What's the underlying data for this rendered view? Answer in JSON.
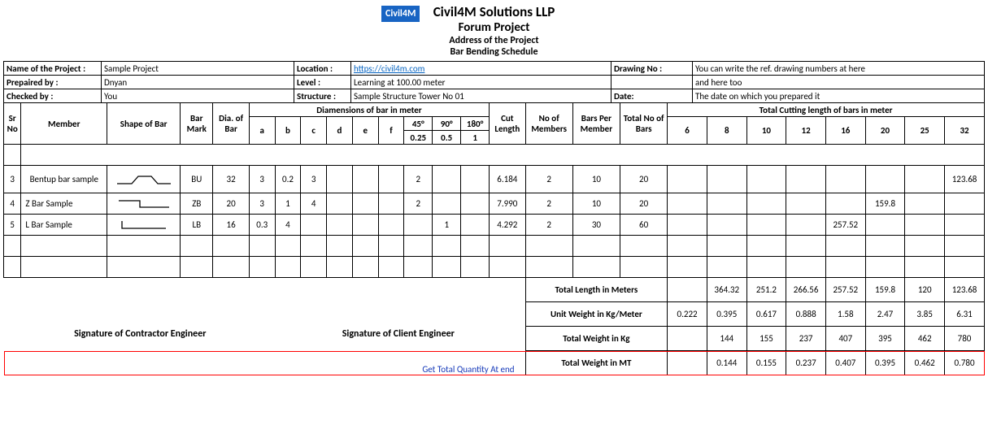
{
  "logo": "Civil4M",
  "title": "Civil4M Solutions LLP",
  "subtitle": "Forum Project",
  "address": "Address of the Project",
  "doc": "Bar Bending Schedule",
  "labels": {
    "name": "Name of the Project :",
    "prep": "Prepaired by :",
    "chk": "Checked by :",
    "loc": "Location :",
    "lvl": "Level :",
    "struct": "Structure :",
    "dwg": "Drawing No :",
    "date": "Date:"
  },
  "info": {
    "name": "Sample Project",
    "prep": "Dnyan",
    "chk": "You",
    "loc_url": "https://civil4m.com",
    "lvl": "Learning at 100.00 meter",
    "struct": "Sample Structure Tower No 01",
    "dwg1": "You can write the ref. drawing numbers at here",
    "dwg2": "and here too",
    "date": "The date on which you prepared it"
  },
  "colhdr": {
    "sr": "Sr No",
    "member": "Member",
    "shape": "Shape of Bar",
    "mark": "Bar Mark",
    "dia": "Dia. of Bar",
    "dims": "Diamensions of bar in meter",
    "a": "a",
    "b": "b",
    "c": "c",
    "d": "d",
    "e": "e",
    "f": "f",
    "d45": "45°",
    "d90": "90°",
    "d180": "180°",
    "cut": "Cut Length",
    "v45": "0.25",
    "v90": "0.5",
    "v180": "1",
    "nomem": "No of Members",
    "bpm": "Bars Per Member",
    "tot": "Total No of Bars",
    "totcut": "Total Cutting length of bars in meter",
    "c6": "6",
    "c8": "8",
    "c10": "10",
    "c12": "12",
    "c16": "16",
    "c20": "20",
    "c25": "25",
    "c32": "32"
  },
  "rows": [
    {
      "sr": "3",
      "member": "Bentup bar sample",
      "shape": "bentup",
      "mark": "BU",
      "dia": "32",
      "a": "3",
      "b": "0.2",
      "c": "3",
      "d45": "2",
      "cut": "6.184",
      "nomem": "2",
      "bpm": "10",
      "tot": "20",
      "c32": "123.68"
    },
    {
      "sr": "4",
      "member": "Z Bar Sample",
      "shape": "zbar",
      "mark": "ZB",
      "dia": "20",
      "a": "3",
      "b": "1",
      "c": "4",
      "d45": "2",
      "cut": "7.990",
      "nomem": "2",
      "bpm": "10",
      "tot": "20",
      "c20": "159.8"
    },
    {
      "sr": "5",
      "member": "L Bar Sample",
      "shape": "lbar",
      "mark": "LB",
      "dia": "16",
      "a": "0.3",
      "b": "4",
      "d90": "1",
      "cut": "4.292",
      "nomem": "2",
      "bpm": "30",
      "tot": "60",
      "c16": "257.52"
    }
  ],
  "summary": {
    "tl_lbl": "Total Length in Meters",
    "tl": [
      "",
      "364.32",
      "251.2",
      "266.56",
      "257.52",
      "159.8",
      "120",
      "123.68"
    ],
    "uw_lbl": "Unit Weight in Kg/Meter",
    "uw": [
      "0.222",
      "0.395",
      "0.617",
      "0.888",
      "1.58",
      "2.47",
      "3.85",
      "6.31"
    ],
    "tk_lbl": "Total Weight in Kg",
    "tk": [
      "",
      "144",
      "155",
      "237",
      "407",
      "395",
      "462",
      "780"
    ],
    "tm_lbl": "Total Weight in MT",
    "tm": [
      "",
      "0.144",
      "0.155",
      "0.237",
      "0.407",
      "0.395",
      "0.462",
      "0.780"
    ]
  },
  "sig1": "Signature of Contractor Engineer",
  "sig2": "Signature of Client Engineer",
  "annot": "Get Total Quantity At end",
  "chart_data": {
    "type": "table",
    "title": "Bar Bending Schedule",
    "series": [
      {
        "name": "Total Length in Meters",
        "categories": [
          "6",
          "8",
          "10",
          "12",
          "16",
          "20",
          "25",
          "32"
        ],
        "values": [
          null,
          364.32,
          251.2,
          266.56,
          257.52,
          159.8,
          120,
          123.68
        ]
      },
      {
        "name": "Unit Weight in Kg/Meter",
        "categories": [
          "6",
          "8",
          "10",
          "12",
          "16",
          "20",
          "25",
          "32"
        ],
        "values": [
          0.222,
          0.395,
          0.617,
          0.888,
          1.58,
          2.47,
          3.85,
          6.31
        ]
      },
      {
        "name": "Total Weight in Kg",
        "categories": [
          "6",
          "8",
          "10",
          "12",
          "16",
          "20",
          "25",
          "32"
        ],
        "values": [
          null,
          144,
          155,
          237,
          407,
          395,
          462,
          780
        ]
      },
      {
        "name": "Total Weight in MT",
        "categories": [
          "6",
          "8",
          "10",
          "12",
          "16",
          "20",
          "25",
          "32"
        ],
        "values": [
          null,
          0.144,
          0.155,
          0.237,
          0.407,
          0.395,
          0.462,
          0.78
        ]
      }
    ]
  }
}
